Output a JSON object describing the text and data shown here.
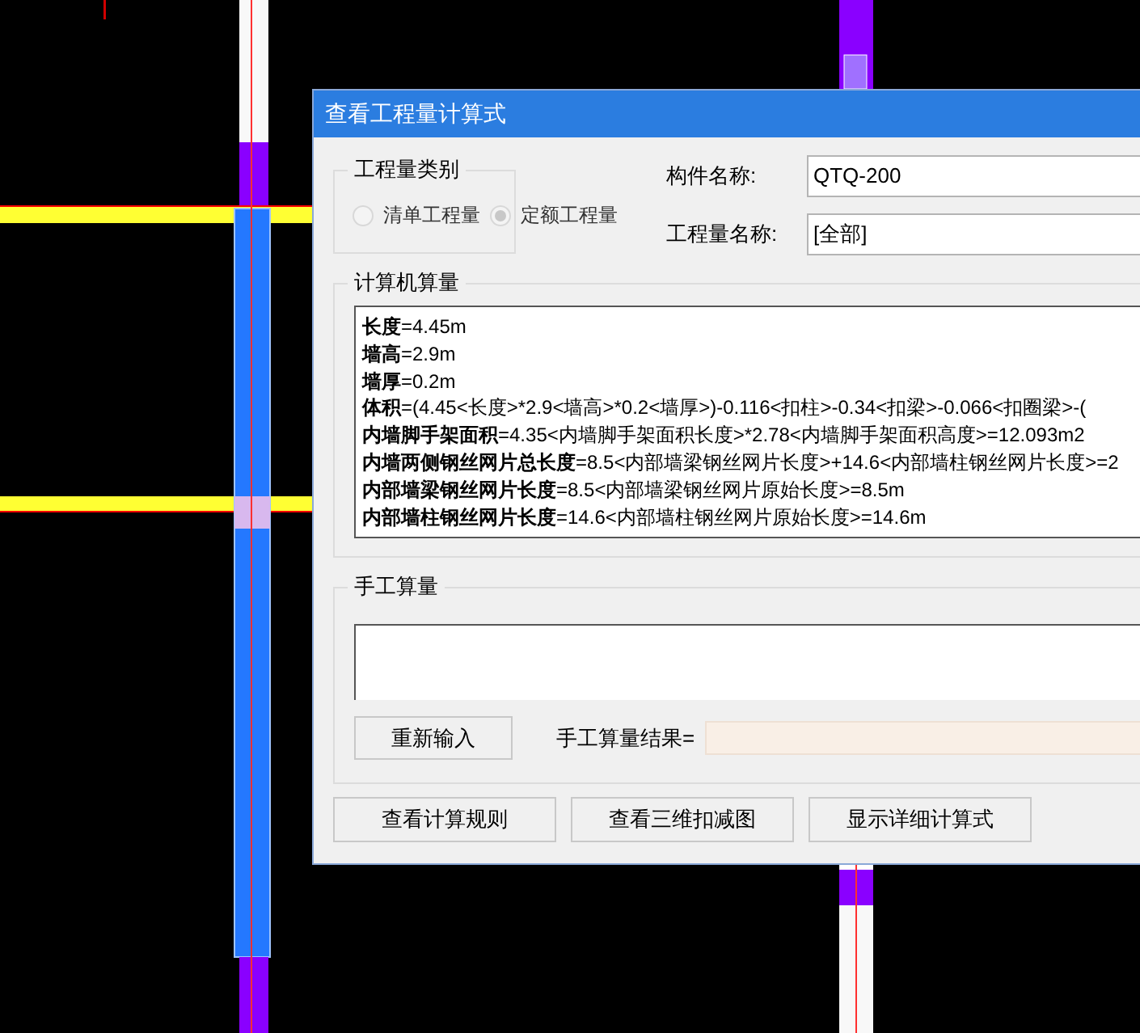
{
  "window": {
    "title": "查看工程量计算式"
  },
  "quantity_type": {
    "legend": "工程量类别",
    "options": [
      {
        "label": "清单工程量",
        "selected": false,
        "disabled": true
      },
      {
        "label": "定额工程量",
        "selected": true,
        "disabled": true
      }
    ]
  },
  "fields": [
    {
      "label": "构件名称:",
      "value": "QTQ-200"
    },
    {
      "label": "工程量名称:",
      "value": "[全部]"
    }
  ],
  "computed": {
    "legend": "计算机算量",
    "lines": [
      "**长度**=4.45m",
      "**墙高**=2.9m",
      "**墙厚**=0.2m",
      "**体积**=(4.45<长度>*2.9<墙高>*0.2<墙厚>)-0.116<扣柱>-0.34<扣梁>-0.066<扣圈梁>-(",
      "**内墙脚手架面积**=4.35<内墙脚手架面积长度>*2.78<内墙脚手架面积高度>=12.093m2",
      "**内墙两侧钢丝网片总长度**=8.5<内部墙梁钢丝网片长度>+14.6<内部墙柱钢丝网片长度>=2",
      "**内部墙梁钢丝网片长度**=8.5<内部墙梁钢丝网片原始长度>=8.5m",
      "**内部墙柱钢丝网片长度**=14.6<内部墙柱钢丝网片原始长度>=14.6m"
    ]
  },
  "manual": {
    "legend": "手工算量",
    "reset_button": "重新输入",
    "result_label": "手工算量结果="
  },
  "buttons": [
    "查看计算规则",
    "查看三维扣减图",
    "显示详细计算式"
  ]
}
